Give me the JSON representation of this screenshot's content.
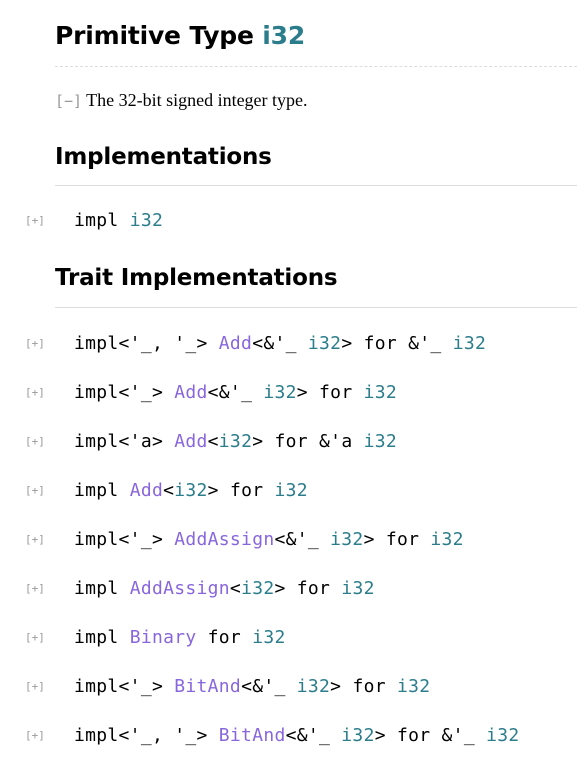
{
  "header": {
    "kind_label": "Primitive Type",
    "type_name": "i32",
    "collapse_toggle": "[−]",
    "description": "The 32-bit signed integer type."
  },
  "sections": [
    {
      "heading": "Implementations",
      "rows": [
        {
          "toggle": "[+]",
          "parts": [
            {
              "t": "impl ",
              "k": "kw"
            },
            {
              "t": "i32",
              "k": "prim"
            }
          ]
        }
      ]
    },
    {
      "heading": "Trait Implementations",
      "rows": [
        {
          "toggle": "[+]",
          "parts": [
            {
              "t": "impl<'_, '_> ",
              "k": "kw"
            },
            {
              "t": "Add",
              "k": "trait"
            },
            {
              "t": "<&'_ ",
              "k": "kw"
            },
            {
              "t": "i32",
              "k": "prim"
            },
            {
              "t": "> for &'_ ",
              "k": "kw"
            },
            {
              "t": "i32",
              "k": "prim"
            }
          ]
        },
        {
          "toggle": "[+]",
          "parts": [
            {
              "t": "impl<'_> ",
              "k": "kw"
            },
            {
              "t": "Add",
              "k": "trait"
            },
            {
              "t": "<&'_ ",
              "k": "kw"
            },
            {
              "t": "i32",
              "k": "prim"
            },
            {
              "t": "> for ",
              "k": "kw"
            },
            {
              "t": "i32",
              "k": "prim"
            }
          ]
        },
        {
          "toggle": "[+]",
          "parts": [
            {
              "t": "impl<'a> ",
              "k": "kw"
            },
            {
              "t": "Add",
              "k": "trait"
            },
            {
              "t": "<",
              "k": "kw"
            },
            {
              "t": "i32",
              "k": "prim"
            },
            {
              "t": "> for &'a ",
              "k": "kw"
            },
            {
              "t": "i32",
              "k": "prim"
            }
          ]
        },
        {
          "toggle": "[+]",
          "parts": [
            {
              "t": "impl ",
              "k": "kw"
            },
            {
              "t": "Add",
              "k": "trait"
            },
            {
              "t": "<",
              "k": "kw"
            },
            {
              "t": "i32",
              "k": "prim"
            },
            {
              "t": "> for ",
              "k": "kw"
            },
            {
              "t": "i32",
              "k": "prim"
            }
          ]
        },
        {
          "toggle": "[+]",
          "parts": [
            {
              "t": "impl<'_> ",
              "k": "kw"
            },
            {
              "t": "AddAssign",
              "k": "trait"
            },
            {
              "t": "<&'_ ",
              "k": "kw"
            },
            {
              "t": "i32",
              "k": "prim"
            },
            {
              "t": "> for ",
              "k": "kw"
            },
            {
              "t": "i32",
              "k": "prim"
            }
          ]
        },
        {
          "toggle": "[+]",
          "parts": [
            {
              "t": "impl ",
              "k": "kw"
            },
            {
              "t": "AddAssign",
              "k": "trait"
            },
            {
              "t": "<",
              "k": "kw"
            },
            {
              "t": "i32",
              "k": "prim"
            },
            {
              "t": "> for ",
              "k": "kw"
            },
            {
              "t": "i32",
              "k": "prim"
            }
          ]
        },
        {
          "toggle": "[+]",
          "parts": [
            {
              "t": "impl ",
              "k": "kw"
            },
            {
              "t": "Binary",
              "k": "trait"
            },
            {
              "t": " for ",
              "k": "kw"
            },
            {
              "t": "i32",
              "k": "prim"
            }
          ]
        },
        {
          "toggle": "[+]",
          "parts": [
            {
              "t": "impl<'_> ",
              "k": "kw"
            },
            {
              "t": "BitAnd",
              "k": "trait"
            },
            {
              "t": "<&'_ ",
              "k": "kw"
            },
            {
              "t": "i32",
              "k": "prim"
            },
            {
              "t": "> for ",
              "k": "kw"
            },
            {
              "t": "i32",
              "k": "prim"
            }
          ]
        },
        {
          "toggle": "[+]",
          "parts": [
            {
              "t": "impl<'_, '_> ",
              "k": "kw"
            },
            {
              "t": "BitAnd",
              "k": "trait"
            },
            {
              "t": "<&'_ ",
              "k": "kw"
            },
            {
              "t": "i32",
              "k": "prim"
            },
            {
              "t": "> for &'_ ",
              "k": "kw"
            },
            {
              "t": "i32",
              "k": "prim"
            }
          ]
        }
      ]
    }
  ],
  "colors": {
    "primitive": "#2c7d8c",
    "trait": "#8866dd",
    "toggle": "#999999",
    "rule": "#dddddd"
  }
}
